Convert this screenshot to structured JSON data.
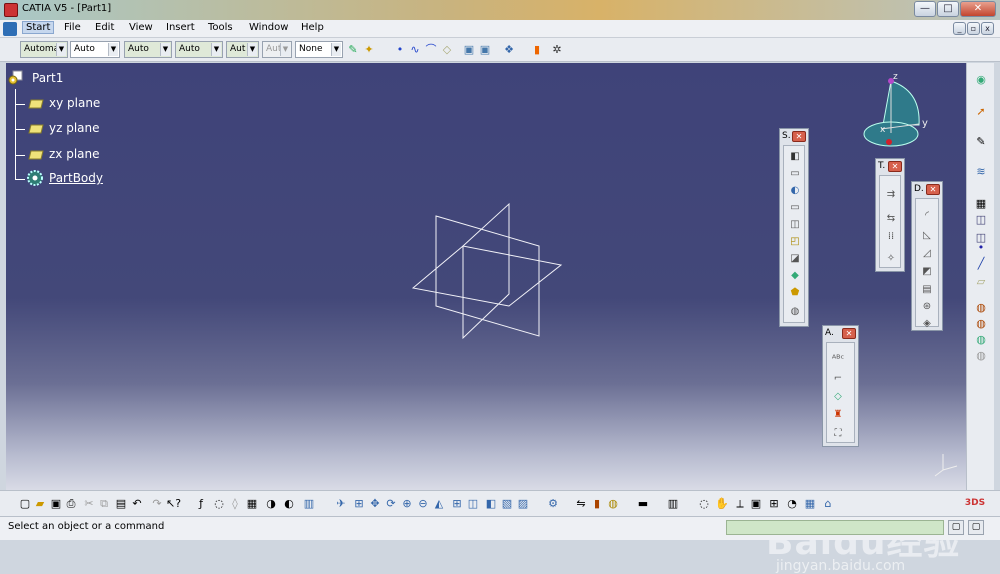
{
  "app": {
    "title": "CATIA V5 - [Part1]"
  },
  "menu": {
    "items": [
      "Start",
      "File",
      "Edit",
      "View",
      "Insert",
      "Tools",
      "Window",
      "Help"
    ]
  },
  "graphic_toolbar": {
    "combos": [
      {
        "value": "Automa",
        "kind": "green"
      },
      {
        "value": "Auto",
        "kind": "white"
      },
      {
        "value": "Auto",
        "kind": "green"
      },
      {
        "value": "Auto",
        "kind": "green"
      },
      {
        "value": "Aut",
        "kind": "green"
      },
      {
        "value": "Aut",
        "kind": "disabled"
      },
      {
        "value": "None",
        "kind": "white"
      }
    ]
  },
  "tree": {
    "root": "Part1",
    "items": [
      "xy plane",
      "yz plane",
      "zx plane",
      "PartBody"
    ]
  },
  "panels": {
    "sketch_based": "S.",
    "transformation": "T.",
    "dress_up": "D.",
    "analysis": "A."
  },
  "compass": {
    "x": "x",
    "y": "y",
    "z": "z"
  },
  "status": {
    "message": "Select an object or a command"
  },
  "watermark": {
    "text": "Baidu经验",
    "url": "jingyan.baidu.com"
  },
  "colors": {
    "viewport_top": "#3f4379",
    "viewport_bottom": "#d9dbe6",
    "accent": "#d6604c"
  }
}
